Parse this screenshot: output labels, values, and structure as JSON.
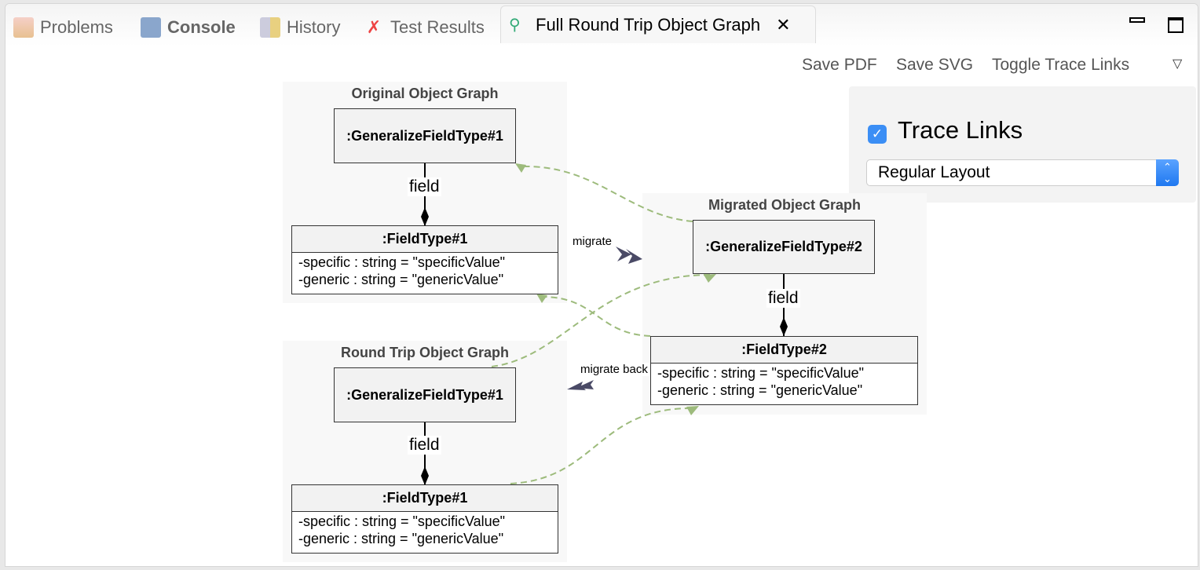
{
  "tabs": [
    {
      "label": "Problems",
      "icon": "problems-icon"
    },
    {
      "label": "Console",
      "icon": "console-icon"
    },
    {
      "label": "History",
      "icon": "history-icon"
    },
    {
      "label": "Test Results",
      "icon": "test-results-icon"
    },
    {
      "label": "Full Round Trip Object Graph",
      "icon": "object-graph-icon",
      "active": true
    }
  ],
  "toolbar": {
    "save_pdf": "Save PDF",
    "save_svg": "Save SVG",
    "toggle": "Toggle Trace Links"
  },
  "panel": {
    "trace_links_label": "Trace Links",
    "trace_links_checked": true,
    "layout_value": "Regular Layout"
  },
  "graphs": {
    "original": {
      "title": "Original Object Graph",
      "obj": ":GeneralizeFieldType#1",
      "link": "field",
      "cls": ":FieldType#1",
      "attrs": [
        "-specific : string = \"specificValue\"",
        "-generic : string = \"genericValue\""
      ]
    },
    "migrated": {
      "title": "Migrated Object Graph",
      "obj": ":GeneralizeFieldType#2",
      "link": "field",
      "cls": ":FieldType#2",
      "attrs": [
        "-specific : string = \"specificValue\"",
        "-generic : string = \"genericValue\""
      ]
    },
    "roundtrip": {
      "title": "Round Trip Object Graph",
      "obj": ":GeneralizeFieldType#1",
      "link": "field",
      "cls": ":FieldType#1",
      "attrs": [
        "-specific : string = \"specificValue\"",
        "-generic : string = \"genericValue\""
      ]
    }
  },
  "edges": {
    "migrate": "migrate",
    "migrate_back": "migrate back"
  },
  "colors": {
    "trace": "#9dbb7c",
    "arrow": "#4a4a66",
    "checkbox": "#3b8ef5"
  }
}
